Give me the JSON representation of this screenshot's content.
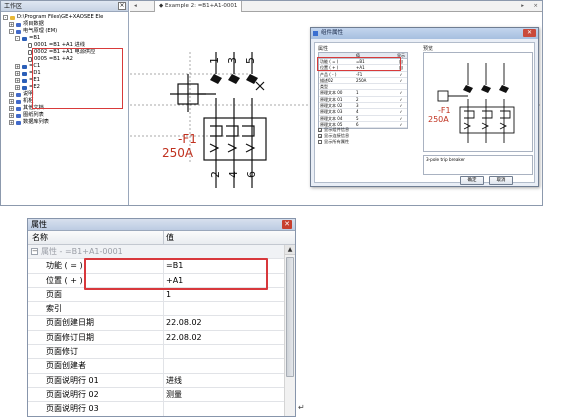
{
  "top": {
    "left_panel": {
      "title": "工作区",
      "tree": [
        {
          "label": "D:\\Program Files\\GE+XAOSEE Ele",
          "indent": 0,
          "icon": "folder",
          "toggle": "-"
        },
        {
          "label": "项目数据",
          "indent": 1,
          "icon": "grp",
          "toggle": "+"
        },
        {
          "label": "电气原理 (EM)",
          "indent": 1,
          "icon": "grp",
          "toggle": "-"
        },
        {
          "label": "=B1",
          "indent": 2,
          "icon": "dev",
          "toggle": "-"
        },
        {
          "label": "0001 =B1 +A1 进线",
          "indent": 3,
          "icon": "page",
          "toggle": ""
        },
        {
          "label": "0002 =B1 +A1 电源供应",
          "indent": 3,
          "icon": "page",
          "toggle": ""
        },
        {
          "label": "0005 =B1 +A2",
          "indent": 3,
          "icon": "page",
          "toggle": ""
        },
        {
          "label": "=C1",
          "indent": 2,
          "icon": "dev",
          "toggle": "+"
        },
        {
          "label": "=D1",
          "indent": 2,
          "icon": "dev",
          "toggle": "+"
        },
        {
          "label": "=E1",
          "indent": 2,
          "icon": "dev",
          "toggle": "+"
        },
        {
          "label": "=E2",
          "indent": 2,
          "icon": "dev",
          "toggle": "+"
        },
        {
          "label": "说明",
          "indent": 1,
          "icon": "grp",
          "toggle": "+"
        },
        {
          "label": "机柜",
          "indent": 1,
          "icon": "grp",
          "toggle": "+"
        },
        {
          "label": "其他文档",
          "indent": 1,
          "icon": "grp",
          "toggle": "+"
        },
        {
          "label": "图纸列表",
          "indent": 1,
          "icon": "grp",
          "toggle": "+"
        },
        {
          "label": "数据库列表",
          "indent": 1,
          "icon": "grp",
          "toggle": "+"
        }
      ]
    },
    "drawing": {
      "nav_left": "◂",
      "tab_label": "Example 2: =B1+A1-0001",
      "nav_right": "▸",
      "close_glyph": "×",
      "terminals_top": [
        "1",
        "3",
        "5"
      ],
      "terminals_bottom": [
        "2",
        "4",
        "6"
      ],
      "device_tag": "-F1",
      "device_rating": "250A"
    },
    "dialog": {
      "title": "组件属性",
      "close_glyph": "✕",
      "properties_label": "属性",
      "preview_label": "预览",
      "table_headers": [
        "",
        "值",
        "显示"
      ],
      "rows": [
        {
          "name": "功能 ( = )",
          "value": "=B1",
          "show": "自"
        },
        {
          "name": "位置 ( + )",
          "value": "+A1",
          "show": "自"
        },
        {
          "name": "产品 ( - )",
          "value": "-F1",
          "show": "✓"
        },
        {
          "name": "描述02",
          "value": "250A",
          "show": "✓"
        },
        {
          "name": "类型",
          "value": "",
          "show": ""
        },
        {
          "name": "原理文本 00",
          "value": "1",
          "show": "✓"
        },
        {
          "name": "原理文本 01",
          "value": "2",
          "show": "✓"
        },
        {
          "name": "原理文本 02",
          "value": "3",
          "show": "✓"
        },
        {
          "name": "原理文本 03",
          "value": "4",
          "show": "✓"
        },
        {
          "name": "原理文本 04",
          "value": "5",
          "show": "✓"
        },
        {
          "name": "原理文本 05",
          "value": "6",
          "show": "✓"
        }
      ],
      "checks": [
        {
          "label": "显示组件信息",
          "checked": true
        },
        {
          "label": "显示连接信息",
          "checked": true
        },
        {
          "label": "显示所有属性",
          "checked": false
        }
      ],
      "preview_tag": "-F1",
      "preview_rating": "250A",
      "description": "3-pole trip breaker",
      "ok_label": "确定",
      "cancel_label": "取消"
    }
  },
  "bottom": {
    "title": "属性",
    "close_glyph": "✕",
    "header_name": "名称",
    "header_value": "值",
    "group_toggle": "−",
    "group_label": "属性 - =B1+A1-0001",
    "rows": [
      {
        "name": "功能 ( = )",
        "value": "=B1"
      },
      {
        "name": "位置 ( + )",
        "value": "+A1"
      },
      {
        "name": "页面",
        "value": "1"
      },
      {
        "name": "索引",
        "value": ""
      },
      {
        "name": "页面创建日期",
        "value": "22.08.02"
      },
      {
        "name": "页面修订日期",
        "value": "22.08.02"
      },
      {
        "name": "页面修订",
        "value": ""
      },
      {
        "name": "页面创建者",
        "value": ""
      },
      {
        "name": "页面说明行 01",
        "value": "进线"
      },
      {
        "name": "页面说明行 02",
        "value": "测量"
      },
      {
        "name": "页面说明行 03",
        "value": ""
      }
    ],
    "scroll_up_glyph": "▲",
    "trailing_mark": "↵"
  },
  "colors": {
    "highlight_red": "#d83a3a",
    "schematic_red": "#c0311f",
    "title_blue": "#bccbe2"
  }
}
